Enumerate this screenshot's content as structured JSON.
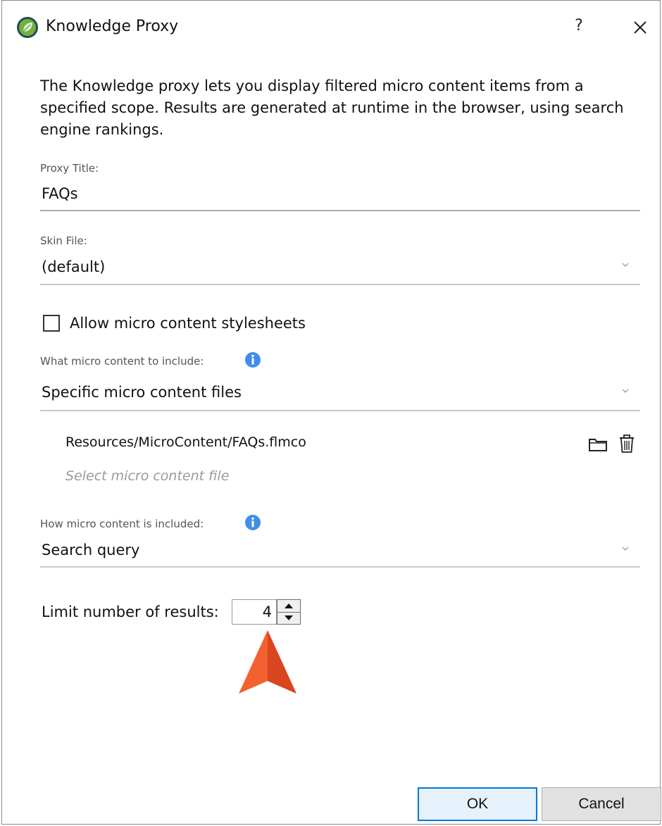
{
  "dialog": {
    "title": "Knowledge Proxy",
    "help_label": "?",
    "description": "The Knowledge proxy lets you display filtered micro content items from a specified scope. Results are generated at runtime in the browser, using search engine rankings."
  },
  "proxy_title": {
    "label": "Proxy Title:",
    "value": "FAQs"
  },
  "skin_file": {
    "label": "Skin File:",
    "value": "(default)"
  },
  "allow_stylesheets": {
    "label": "Allow micro content stylesheets",
    "checked": false
  },
  "include_content": {
    "label": "What micro content to include:",
    "value": "Specific micro content files"
  },
  "files": {
    "items": [
      "Resources/MicroContent/FAQs.flmco"
    ],
    "placeholder": "Select micro content file"
  },
  "how_included": {
    "label": "How micro content is included:",
    "value": "Search query"
  },
  "limit": {
    "label": "Limit number of results:",
    "value": "4"
  },
  "buttons": {
    "ok": "OK",
    "cancel": "Cancel"
  },
  "colors": {
    "accent": "#0078d7",
    "info": "#1e88e5",
    "arrow": "#e8542a",
    "logo": "#5aa12e"
  },
  "icons": [
    "app-logo-icon",
    "help-icon",
    "close-icon",
    "chevron-down-icon",
    "info-icon",
    "folder-icon",
    "trash-icon",
    "spin-up-icon",
    "spin-down-icon",
    "pointer-arrow-icon"
  ]
}
